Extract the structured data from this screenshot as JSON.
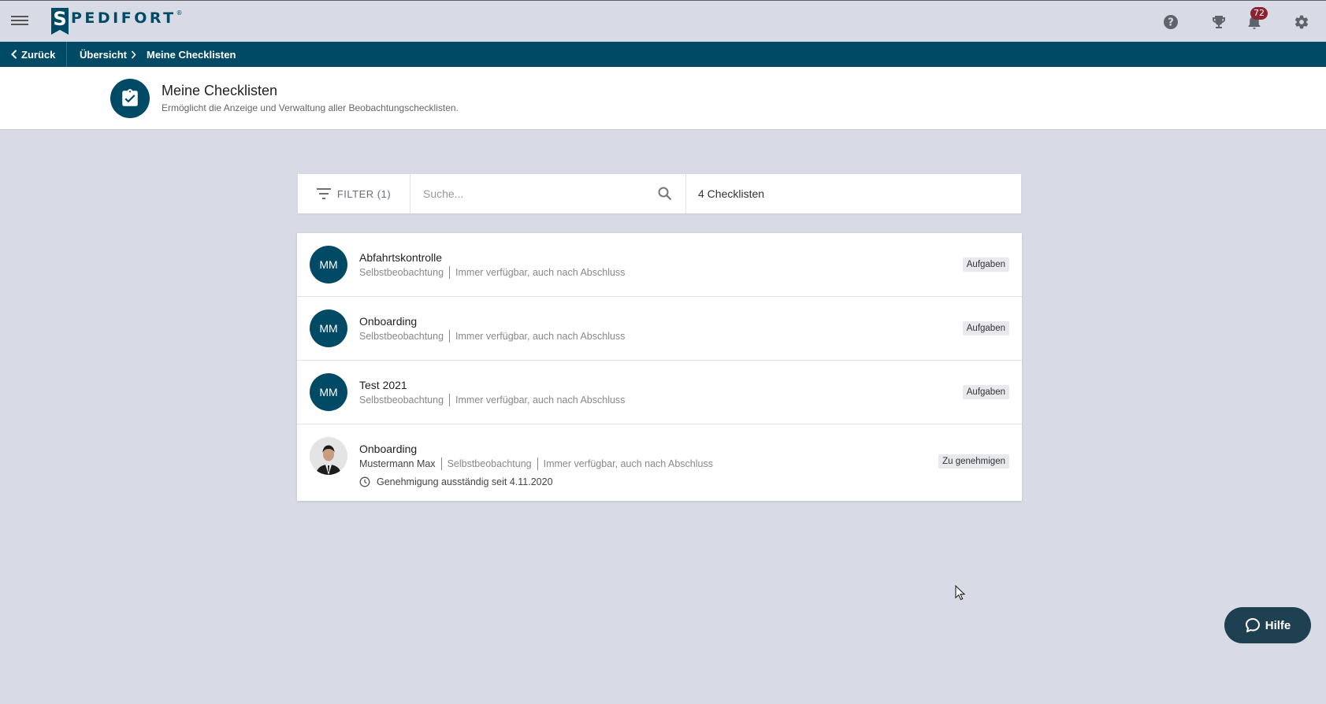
{
  "app": {
    "logo_letter": "S",
    "logo_text": "PEDIFORT",
    "logo_reg": "®",
    "notification_count": "72"
  },
  "breadcrumb": {
    "back_label": "Zurück",
    "items": [
      "Übersicht",
      "Meine Checklisten"
    ]
  },
  "page": {
    "title": "Meine Checklisten",
    "subtitle": "Ermöglicht die Anzeige und Verwaltung aller Beobachtungschecklisten."
  },
  "toolbar": {
    "filter_label": "FILTER (1)",
    "search_placeholder": "Suche...",
    "count_label": "4 Checklisten"
  },
  "checklists": [
    {
      "avatar": "MM",
      "title": "Abfahrtskontrolle",
      "type": "Selbstbeobachtung",
      "availability": "Immer verfügbar, auch nach Abschluss",
      "tag": "Aufgaben"
    },
    {
      "avatar": "MM",
      "title": "Onboarding",
      "type": "Selbstbeobachtung",
      "availability": "Immer verfügbar, auch nach Abschluss",
      "tag": "Aufgaben"
    },
    {
      "avatar": "MM",
      "title": "Test 2021",
      "type": "Selbstbeobachtung",
      "availability": "Immer verfügbar, auch nach Abschluss",
      "tag": "Aufgaben"
    },
    {
      "title": "Onboarding",
      "owner": "Mustermann Max",
      "type": "Selbstbeobachtung",
      "availability": "Immer verfügbar, auch nach Abschluss",
      "status": "Genehmigung ausständig seit 4.11.2020",
      "tag": "Zu genehmigen"
    }
  ],
  "help": {
    "label": "Hilfe"
  },
  "colors": {
    "brand": "#004a66",
    "background": "#d8dbe5",
    "badge": "#8b2332",
    "help": "#1f4050"
  }
}
